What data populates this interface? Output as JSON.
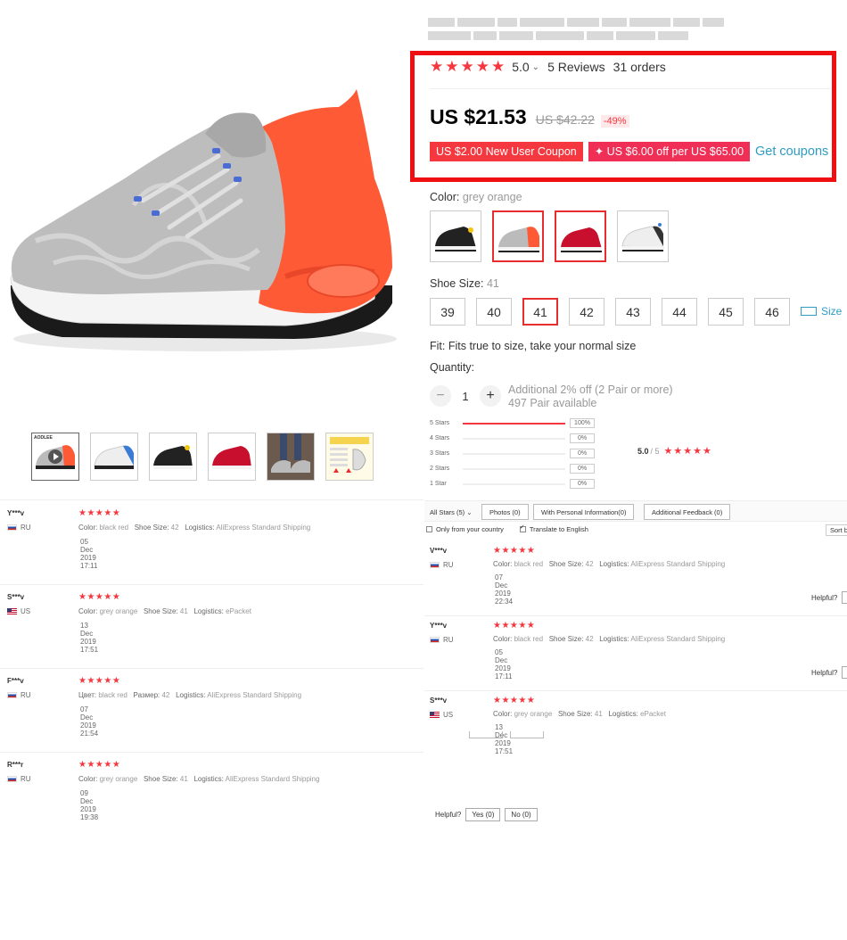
{
  "rating": {
    "stars": "★★★★★",
    "score": "5.0",
    "reviews": "5 Reviews",
    "orders": "31 orders"
  },
  "price": {
    "current": "US $21.53",
    "original": "US $42.22",
    "discount": "-49%"
  },
  "coupons": {
    "new_user": "US $2.00 New User Coupon",
    "store": "✦ US $6.00 off per US $65.00",
    "get_link": "Get coupons"
  },
  "color": {
    "label": "Color:",
    "value": "grey orange",
    "options": [
      "black yellow",
      "grey orange",
      "black red",
      "white black"
    ],
    "selected_index": 1
  },
  "size": {
    "label": "Shoe Size:",
    "value": "41",
    "options": [
      "39",
      "40",
      "41",
      "42",
      "43",
      "44",
      "45",
      "46"
    ],
    "guide": "Size"
  },
  "fit": "Fit: Fits true to size, take your normal size",
  "quantity": {
    "label": "Quantity:",
    "minus": "−",
    "value": "1",
    "plus": "+",
    "promo": "Additional 2% off (2 Pair or more)",
    "available": "497 Pair available"
  },
  "thumbnails": {
    "brand_text": "AODLEE"
  },
  "histogram": {
    "rows": [
      {
        "label": "5 Stars",
        "pct": "100%",
        "fill": 1.0
      },
      {
        "label": "4 Stars",
        "pct": "0%",
        "fill": 0
      },
      {
        "label": "3 Stars",
        "pct": "0%",
        "fill": 0
      },
      {
        "label": "2 Stars",
        "pct": "0%",
        "fill": 0
      },
      {
        "label": "1 Star",
        "pct": "0%",
        "fill": 0
      }
    ],
    "avg": "5.0",
    "of": "/ 5",
    "stars": "★★★★★"
  },
  "feedback_toolbar": {
    "all_stars": "All Stars (5)",
    "photos": "Photos (0)",
    "personal_info": "With Personal Information(0)",
    "additional": "Additional Feedback (0)",
    "only_country": "Only from your country",
    "translate": "Translate to English",
    "sort": "Sort b"
  },
  "reviews_left": [
    {
      "name": "Y***v",
      "country": "RU",
      "stars": "★★★★★",
      "k1": "Color:",
      "v1": "black red",
      "k2": "Shoe Size:",
      "v2": "42",
      "k3": "Logistics:",
      "v3": "AliExpress Standard Shipping",
      "date": "05 Dec 2019 17:11"
    },
    {
      "name": "S***v",
      "country": "US",
      "stars": "★★★★★",
      "k1": "Color:",
      "v1": "grey orange",
      "k2": "Shoe Size:",
      "v2": "41",
      "k3": "Logistics:",
      "v3": "ePacket",
      "date": "13 Dec 2019 17:51"
    },
    {
      "name": "F***v",
      "country": "RU",
      "stars": "★★★★★",
      "k1": "Цвет:",
      "v1": "black red",
      "k2": "Размер:",
      "v2": "42",
      "k3": "Logistics:",
      "v3": "AliExpress Standard Shipping",
      "date": "07 Dec 2019 21:54"
    },
    {
      "name": "R***r",
      "country": "RU",
      "stars": "★★★★★",
      "k1": "Color:",
      "v1": "grey orange",
      "k2": "Shoe Size:",
      "v2": "41",
      "k3": "Logistics:",
      "v3": "AliExpress Standard Shipping",
      "date": "09 Dec 2019 19:38"
    }
  ],
  "reviews_right": [
    {
      "name": "V***v",
      "country": "RU",
      "stars": "★★★★★",
      "k1": "Color:",
      "v1": "black red",
      "k2": "Shoe Size:",
      "v2": "42",
      "k3": "Logistics:",
      "v3": "AliExpress Standard Shipping",
      "date": "07 Dec 2019 22:34",
      "helpful": "Helpful?"
    },
    {
      "name": "Y***v",
      "country": "RU",
      "stars": "★★★★★",
      "k1": "Color:",
      "v1": "black red",
      "k2": "Shoe Size:",
      "v2": "42",
      "k3": "Logistics:",
      "v3": "AliExpress Standard Shipping",
      "date": "05 Dec 2019 17:11",
      "helpful": "Helpful?"
    },
    {
      "name": "S***v",
      "country": "US",
      "stars": "★★★★★",
      "k1": "Color:",
      "v1": "grey orange",
      "k2": "Shoe Size:",
      "v2": "41",
      "k3": "Logistics:",
      "v3": "ePacket",
      "date": "13 Dec 2019 17:51"
    }
  ],
  "helpful_bottom": {
    "label": "Helpful?",
    "yes": "Yes (0)",
    "no": "No (0)"
  }
}
